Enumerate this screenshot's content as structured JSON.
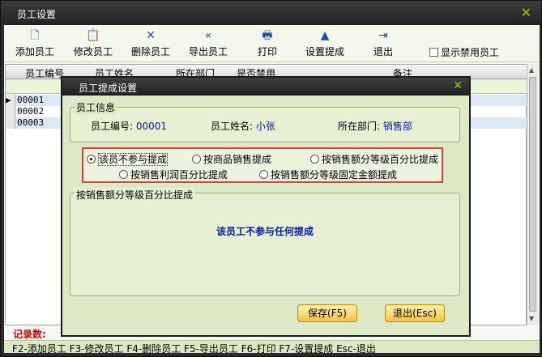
{
  "window": {
    "title": "员工设置",
    "close_glyph": "✕"
  },
  "toolbar": {
    "items": [
      {
        "label": "添加员工",
        "icon": "document-icon",
        "glyph": "🗋"
      },
      {
        "label": "修改员工",
        "icon": "clipboard-icon",
        "glyph": "📋"
      },
      {
        "label": "删除员工",
        "icon": "delete-x-icon",
        "glyph": "✕"
      },
      {
        "label": "导出员工",
        "icon": "double-left-arrow-icon",
        "glyph": "«"
      },
      {
        "label": "打印",
        "icon": "printer-icon",
        "glyph": "🖶"
      },
      {
        "label": "设置提成",
        "icon": "up-triangle-icon",
        "glyph": "▲"
      },
      {
        "label": "退出",
        "icon": "exit-door-icon",
        "glyph": "⇥"
      }
    ],
    "show_disabled": "显示禁用员工"
  },
  "grid": {
    "columns": [
      "员工编号",
      "员工姓名",
      "所在部门",
      "是否禁用",
      "备注"
    ],
    "rows": [
      "00001",
      "00002",
      "00003"
    ]
  },
  "record_count_label": "记录数:",
  "status_bar": "F2-添加员工 F3-修改员工 F4-删除员工 F5-导出员工 F6-打印 F7-设置提成 Esc-退出",
  "dialog": {
    "title": "员工提成设置",
    "close_glyph": "✕",
    "info_group": "员工信息",
    "emp_id_label": "员工编号:",
    "emp_id": "00001",
    "emp_name_label": "员工姓名:",
    "emp_name": "小张",
    "dept_label": "所在部门:",
    "dept": "销售部",
    "options": {
      "none": "该员不参与提成",
      "by_product": "按商品销售提成",
      "by_sales_pct": "按销售额分等级百分比提成",
      "by_profit_pct": "按销售利润百分比提成",
      "by_sales_fixed": "按销售额分等级固定金额提成"
    },
    "selected_option": "none",
    "detail_group": "按销售额分等级百分比提成",
    "message": "该员工不参与任何提成",
    "save_button": "保存(F5)",
    "exit_button": "退出(Esc)"
  },
  "colors": {
    "accent_green": "#8fd400",
    "highlight_red": "#e0403a",
    "value_blue": "#0019a8"
  }
}
